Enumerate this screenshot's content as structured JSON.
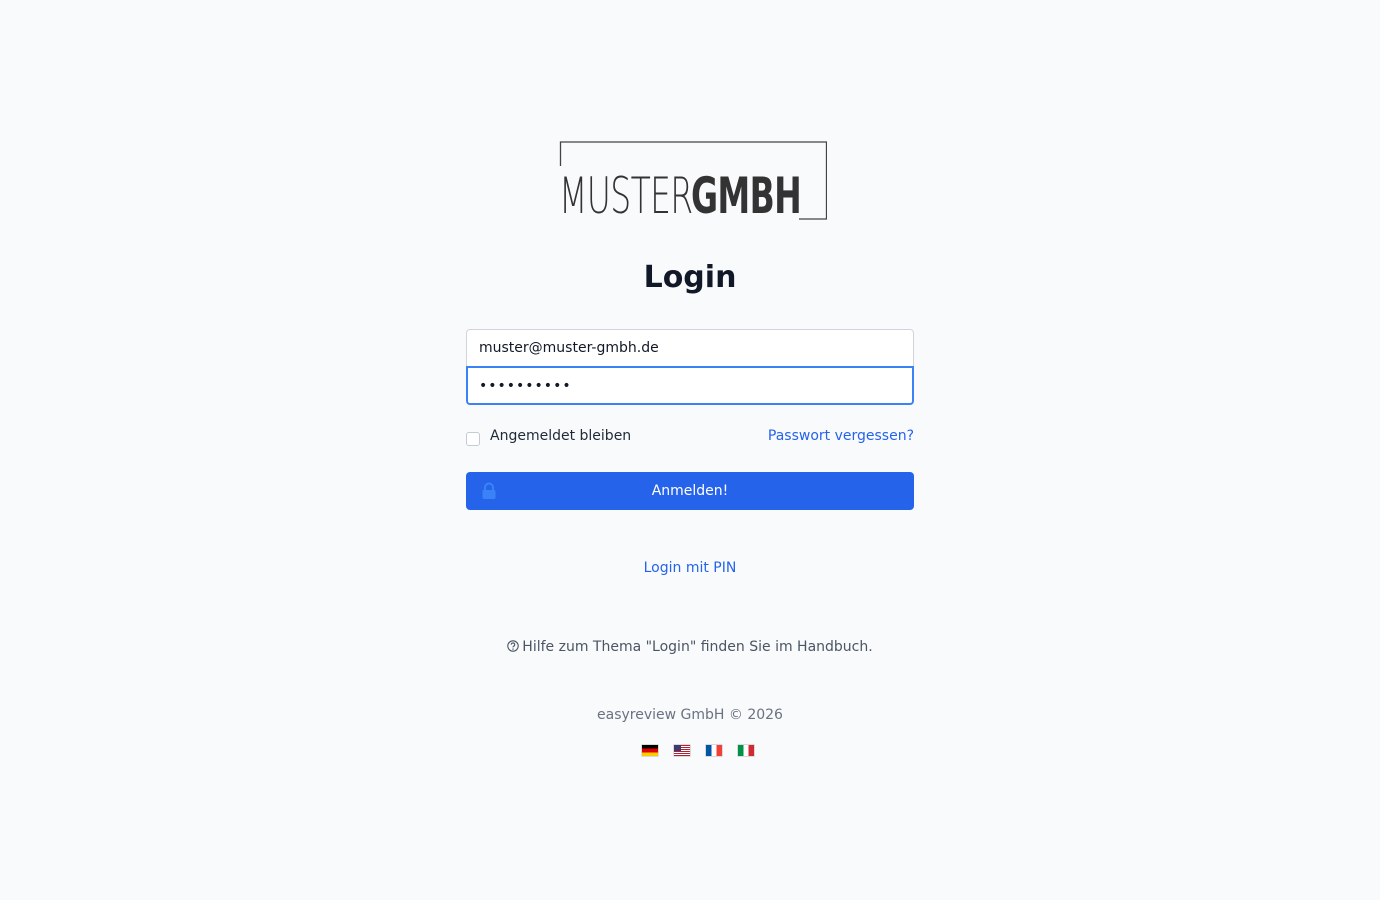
{
  "logo": {
    "part_light": "MUSTER",
    "part_bold": "GMBH"
  },
  "form": {
    "title": "Login",
    "email_value": "muster@muster-gmbh.de",
    "password_value": "••••••••••",
    "remember_label": "Angemeldet bleiben",
    "remember_checked": false,
    "forgot_label": "Passwort vergessen?",
    "submit_label": "Anmelden!",
    "submit_icon": "lock-icon"
  },
  "links": {
    "pin_login": "Login mit PIN"
  },
  "help": {
    "icon": "question-circle-icon",
    "text": "Hilfe zum Thema \"Login\" finden Sie im Handbuch."
  },
  "footer": {
    "copyright": "easyreview GmbH © 2026",
    "languages": [
      {
        "code": "de",
        "icon": "flag-de-icon"
      },
      {
        "code": "us",
        "icon": "flag-us-icon"
      },
      {
        "code": "fr",
        "icon": "flag-fr-icon"
      },
      {
        "code": "it",
        "icon": "flag-it-icon"
      }
    ]
  },
  "colors": {
    "accent": "#2563eb",
    "background": "#f8fafc",
    "focus_border": "#3b82f6"
  }
}
